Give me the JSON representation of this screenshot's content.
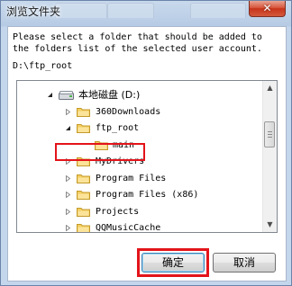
{
  "window": {
    "title": "浏览文件夹",
    "close_symbol": "✕"
  },
  "dialog": {
    "instruction_lines": [
      "Please select a folder that should be added to",
      "the folders list of the selected user account."
    ],
    "selected_path": "D:\\ftp_root"
  },
  "tree": {
    "items": [
      {
        "label": "本地磁盘 (D:)",
        "icon": "hard-drive-icon",
        "expander": "expanded",
        "level": 0
      },
      {
        "label": "360Downloads",
        "icon": "folder-icon",
        "expander": "collapsed",
        "level": 1
      },
      {
        "label": "ftp_root",
        "icon": "folder-icon",
        "expander": "expanded",
        "level": 1,
        "selected": true
      },
      {
        "label": "main",
        "icon": "folder-icon",
        "expander": "none",
        "level": 2
      },
      {
        "label": "MyDrivers",
        "icon": "folder-icon",
        "expander": "collapsed",
        "level": 1
      },
      {
        "label": "Program Files",
        "icon": "folder-icon",
        "expander": "collapsed",
        "level": 1
      },
      {
        "label": "Program Files (x86)",
        "icon": "folder-icon",
        "expander": "collapsed",
        "level": 1
      },
      {
        "label": "Projects",
        "icon": "folder-icon",
        "expander": "collapsed",
        "level": 1
      },
      {
        "label": "QQMusicCache",
        "icon": "folder-icon",
        "expander": "collapsed",
        "level": 1
      }
    ]
  },
  "buttons": {
    "ok_label": "确定",
    "cancel_label": "取消"
  },
  "colors": {
    "highlight": "#e3141a",
    "folder": "#f3cf62",
    "title_bar": "#b6cbe4"
  }
}
